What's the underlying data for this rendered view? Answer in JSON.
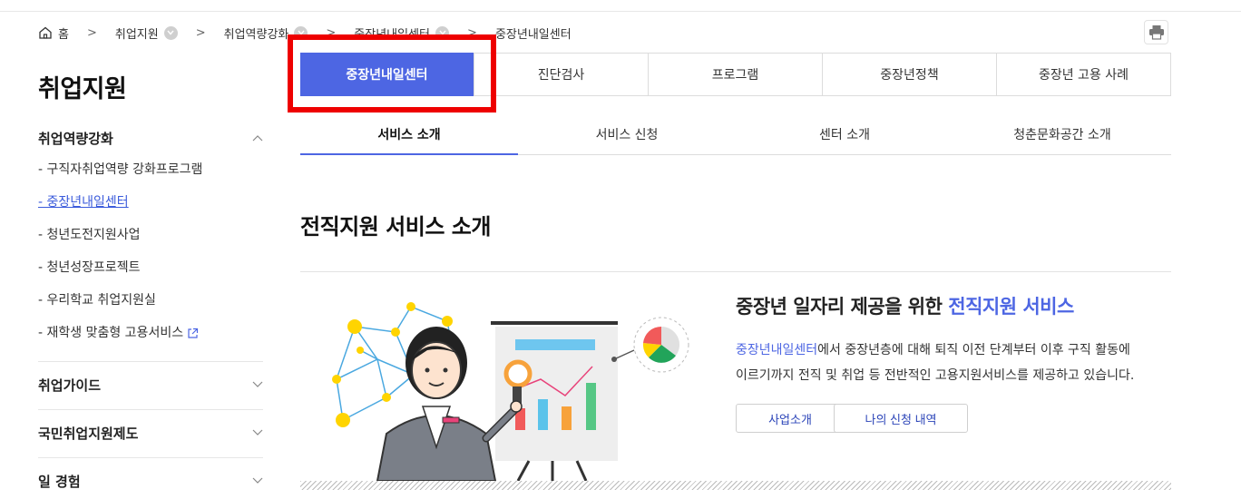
{
  "breadcrumb": {
    "home": "홈",
    "items": [
      "취업지원",
      "취업역량강화",
      "중장년내일센터"
    ],
    "current": "중장년내일센터"
  },
  "sidebar": {
    "title": "취업지원",
    "groups": [
      {
        "label": "취업역량강화",
        "expanded": true,
        "items": [
          "- 구직자취업역량 강화프로그램",
          "- 중장년내일센터",
          "- 청년도전지원사업",
          "- 청년성장프로젝트",
          "- 우리학교 취업지원실",
          "- 재학생 맞춤형 고용서비스"
        ]
      },
      {
        "label": "취업가이드"
      },
      {
        "label": "국민취업지원제도"
      },
      {
        "label": "일 경험"
      }
    ]
  },
  "tabs_primary": [
    "중장년내일센터",
    "진단검사",
    "프로그램",
    "중장년정책",
    "중장년 고용 사례"
  ],
  "tabs_secondary": [
    "서비스 소개",
    "서비스 신청",
    "센터 소개",
    "청춘문화공간 소개"
  ],
  "main": {
    "title": "전직지원 서비스 소개",
    "intro_head_prefix": "중장년 일자리 제공을 위한 ",
    "intro_head_highlight": "전직지원 서비스",
    "intro_body_highlight": "중장년내일센터",
    "intro_body_line1": "에서 중장년층에 대해 퇴직 이전 단계부터 이후 구직 활동에",
    "intro_body_line2": "이르기까지 전직 및 취업 등 전반적인 고용지원서비스를 제공하고 있습니다.",
    "buttons": [
      "사업소개",
      "나의 신청 내역"
    ]
  },
  "colors": {
    "accent": "#4d66e3",
    "highlight_box": "#ee0000"
  }
}
